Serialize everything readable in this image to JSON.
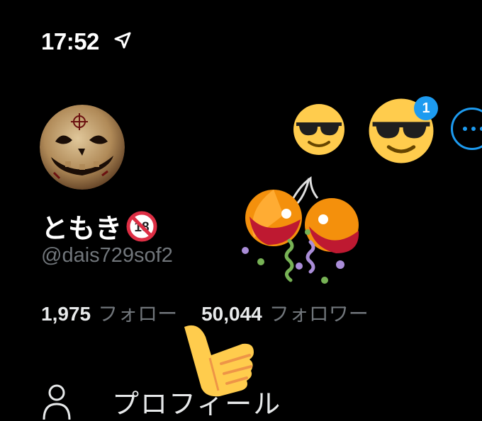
{
  "status_bar": {
    "time": "17:52",
    "icons": [
      "location-arrow-icon"
    ]
  },
  "profile": {
    "display_name": "ともき",
    "name_badge_icon": "no-one-under-eighteen-icon",
    "handle": "@dais729sof2",
    "avatar": "pumpkin-avatar"
  },
  "stats": {
    "following_count": "1,975",
    "following_label": "フォロー",
    "followers_count": "50,044",
    "followers_label": "フォロワー"
  },
  "header_actions": {
    "notification_badge": "1",
    "more_icon": "more-dots-icon"
  },
  "decorations": [
    "sunglasses-emoji",
    "sunglasses-emoji",
    "party-popper-emoji",
    "thumbs-up-emoji"
  ],
  "menu": {
    "profile_label": "プロフィール",
    "profile_icon": "person-icon"
  },
  "colors": {
    "background": "#000000",
    "text_primary": "#e7e9ea",
    "text_secondary": "#71767b",
    "accent": "#1d9bf0",
    "emoji_yellow": "#ffcc4d"
  }
}
